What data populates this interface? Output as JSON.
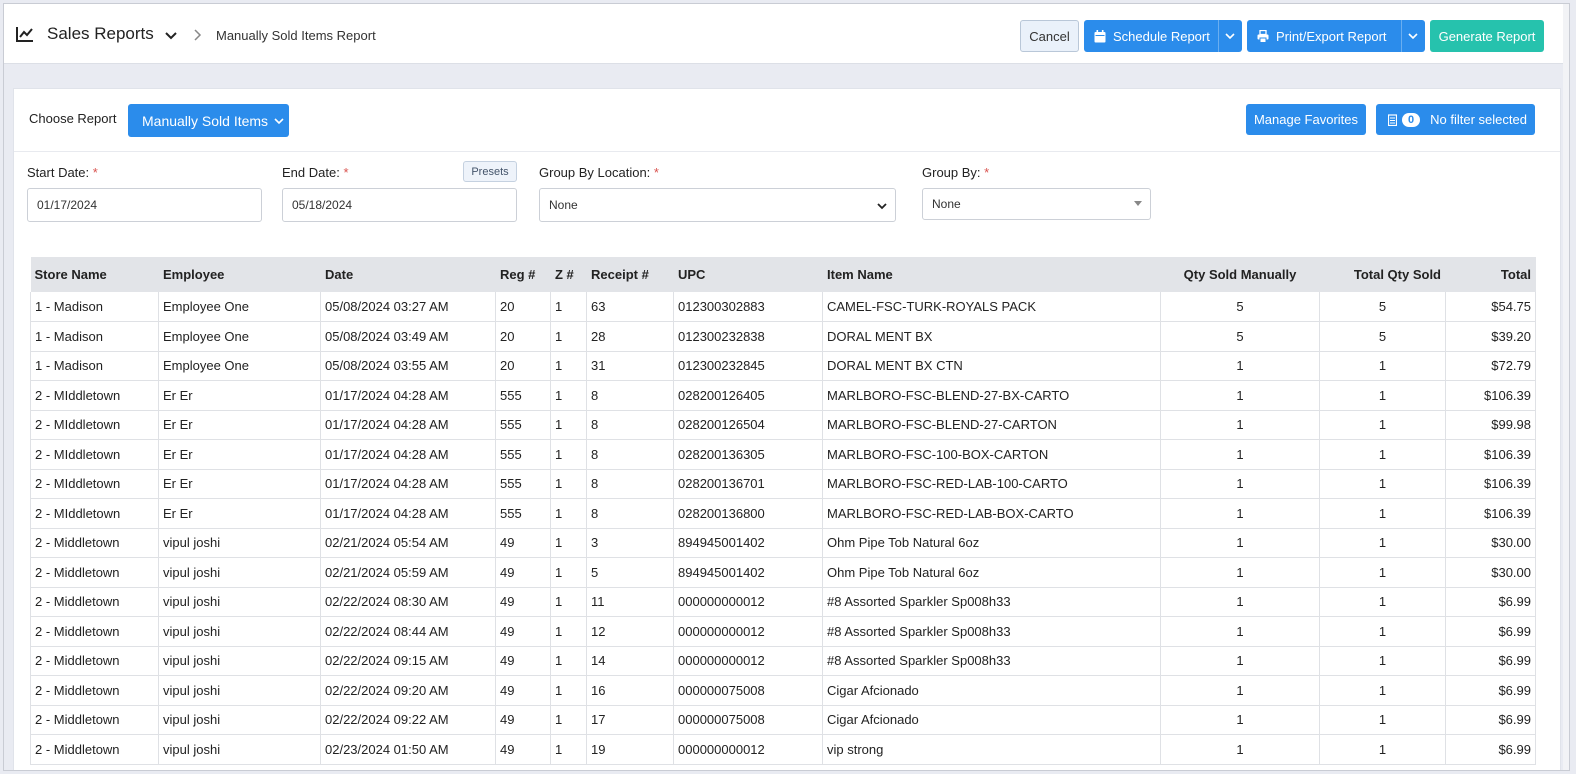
{
  "header": {
    "title": "Sales Reports",
    "breadcrumb": "Manually Sold Items Report",
    "cancel_label": "Cancel",
    "schedule_label": "Schedule Report",
    "print_label": "Print/Export Report",
    "generate_label": "Generate Report"
  },
  "toolbar": {
    "choose_label": "Choose Report",
    "report_selected": "Manually Sold Items",
    "favorites_label": "Manage Favorites",
    "filter_count": "0",
    "filter_label": "No filter selected"
  },
  "filters": {
    "start_label": "Start Date:",
    "start_value": "01/17/2024",
    "end_label": "End Date:",
    "end_value": "05/18/2024",
    "presets_label": "Presets",
    "group_location_label": "Group By Location:",
    "group_location_value": "None",
    "group_by_label": "Group By:",
    "group_by_value": "None",
    "required_mark": "*"
  },
  "table": {
    "columns": [
      "Store Name",
      "Employee",
      "Date",
      "Reg #",
      "Z #",
      "Receipt #",
      "UPC",
      "Item Name",
      "Qty Sold Manually",
      "Total Qty Sold",
      "Total"
    ],
    "rows": [
      [
        "1 - Madison",
        "Employee One",
        "05/08/2024 03:27 AM",
        "20",
        "1",
        "63",
        "012300302883",
        "CAMEL-FSC-TURK-ROYALS PACK",
        "5",
        "5",
        "$54.75"
      ],
      [
        "1 - Madison",
        "Employee One",
        "05/08/2024 03:49 AM",
        "20",
        "1",
        "28",
        "012300232838",
        "DORAL MENT BX",
        "5",
        "5",
        "$39.20"
      ],
      [
        "1 - Madison",
        "Employee One",
        "05/08/2024 03:55 AM",
        "20",
        "1",
        "31",
        "012300232845",
        "DORAL MENT BX CTN",
        "1",
        "1",
        "$72.79"
      ],
      [
        "2 - MIddletown",
        "Er Er",
        "01/17/2024 04:28 AM",
        "555",
        "1",
        "8",
        "028200126405",
        "MARLBORO-FSC-BLEND-27-BX-CARTO",
        "1",
        "1",
        "$106.39"
      ],
      [
        "2 - MIddletown",
        "Er Er",
        "01/17/2024 04:28 AM",
        "555",
        "1",
        "8",
        "028200126504",
        "MARLBORO-FSC-BLEND-27-CARTON",
        "1",
        "1",
        "$99.98"
      ],
      [
        "2 - MIddletown",
        "Er Er",
        "01/17/2024 04:28 AM",
        "555",
        "1",
        "8",
        "028200136305",
        "MARLBORO-FSC-100-BOX-CARTON",
        "1",
        "1",
        "$106.39"
      ],
      [
        "2 - MIddletown",
        "Er Er",
        "01/17/2024 04:28 AM",
        "555",
        "1",
        "8",
        "028200136701",
        "MARLBORO-FSC-RED-LAB-100-CARTO",
        "1",
        "1",
        "$106.39"
      ],
      [
        "2 - MIddletown",
        "Er Er",
        "01/17/2024 04:28 AM",
        "555",
        "1",
        "8",
        "028200136800",
        "MARLBORO-FSC-RED-LAB-BOX-CARTO",
        "1",
        "1",
        "$106.39"
      ],
      [
        "2 - Middletown",
        "vipul joshi",
        "02/21/2024 05:54 AM",
        "49",
        "1",
        "3",
        "894945001402",
        "Ohm Pipe Tob Natural 6oz",
        "1",
        "1",
        "$30.00"
      ],
      [
        "2 - Middletown",
        "vipul joshi",
        "02/21/2024 05:59 AM",
        "49",
        "1",
        "5",
        "894945001402",
        "Ohm Pipe Tob Natural 6oz",
        "1",
        "1",
        "$30.00"
      ],
      [
        "2 - Middletown",
        "vipul joshi",
        "02/22/2024 08:30 AM",
        "49",
        "1",
        "11",
        "000000000012",
        "#8 Assorted Sparkler Sp008h33",
        "1",
        "1",
        "$6.99"
      ],
      [
        "2 - Middletown",
        "vipul joshi",
        "02/22/2024 08:44 AM",
        "49",
        "1",
        "12",
        "000000000012",
        " #8 Assorted Sparkler Sp008h33",
        "1",
        "1",
        "$6.99"
      ],
      [
        "2 - Middletown",
        "vipul joshi",
        "02/22/2024 09:15 AM",
        "49",
        "1",
        "14",
        "000000000012",
        "#8 Assorted Sparkler Sp008h33",
        "1",
        "1",
        "$6.99"
      ],
      [
        "2 - Middletown",
        "vipul joshi",
        "02/22/2024 09:20 AM",
        "49",
        "1",
        "16",
        " 000000075008",
        "Cigar Afcionado",
        "1",
        "1",
        "$6.99"
      ],
      [
        "2 - Middletown",
        "vipul joshi",
        "02/22/2024 09:22 AM",
        "49",
        "1",
        "17",
        " 000000075008",
        "Cigar Afcionado",
        "1",
        "1",
        "$6.99"
      ],
      [
        "2 - Middletown",
        "vipul joshi",
        "02/23/2024 01:50 AM",
        "49",
        "1",
        "19",
        "000000000012",
        "vip strong",
        "1",
        "1",
        "$6.99"
      ]
    ]
  },
  "icons": {
    "chart": "line-chart-icon",
    "calendar": "calendar-icon",
    "printer": "printer-icon",
    "filter": "clipboard-icon"
  },
  "colors": {
    "primary": "#2b8ceb",
    "accent": "#26c2ad",
    "required": "#d9534f"
  }
}
